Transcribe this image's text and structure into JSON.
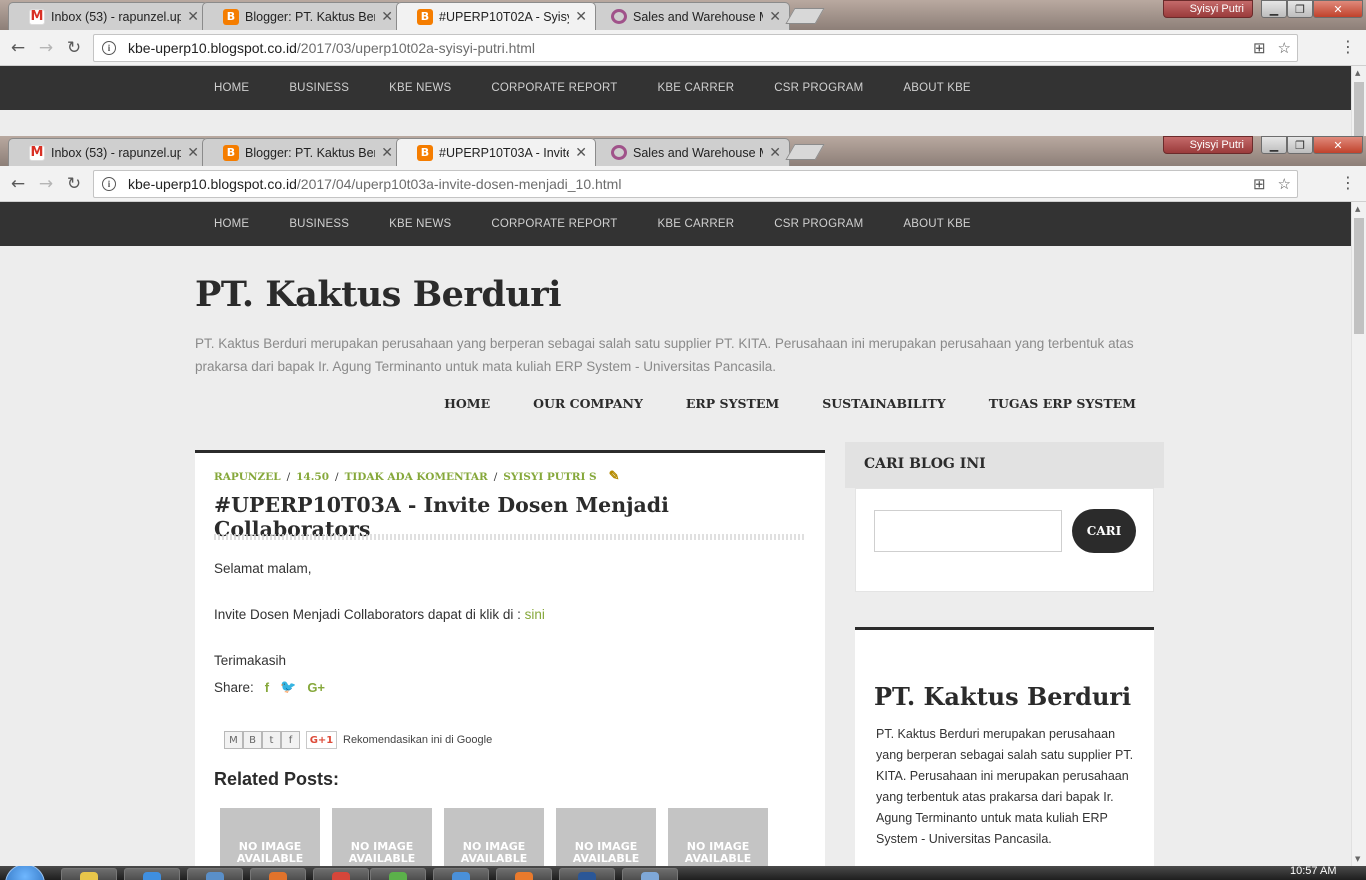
{
  "browser_top": {
    "tabs": [
      {
        "title": "Inbox (53) - rapunzel.upe",
        "icon": "gmail-icon"
      },
      {
        "title": "Blogger: PT. Kaktus Berdu",
        "icon": "blogger-icon"
      },
      {
        "title": "#UPERP10T02A - Syisyi P",
        "icon": "blogger-icon"
      },
      {
        "title": "Sales and Warehouse Ma",
        "icon": "odoo-icon"
      }
    ],
    "user": "Syisyi Putri",
    "url_host": "kbe-uperp10.blogspot.co.id",
    "url_path": "/2017/03/uperp10t02a-syisyi-putri.html"
  },
  "browser_main": {
    "tabs": [
      {
        "title": "Inbox (53) - rapunzel.upe",
        "icon": "gmail-icon"
      },
      {
        "title": "Blogger: PT. Kaktus Berdu",
        "icon": "blogger-icon"
      },
      {
        "title": "#UPERP10T03A - Invite D",
        "icon": "blogger-icon"
      },
      {
        "title": "Sales and Warehouse Ma",
        "icon": "odoo-icon"
      }
    ],
    "user": "Syisyi Putri",
    "url_host": "kbe-uperp10.blogspot.co.id",
    "url_path": "/2017/04/uperp10t03a-invite-dosen-menjadi_10.html"
  },
  "kbe_nav": [
    "HOME",
    "BUSINESS",
    "KBE NEWS",
    "CORPORATE REPORT",
    "KBE CARRER",
    "CSR PROGRAM",
    "ABOUT KBE"
  ],
  "site": {
    "title": "PT. Kaktus Berduri",
    "description": "PT. Kaktus Berduri merupakan perusahaan yang berperan sebagai salah satu supplier PT. KITA. Perusahaan ini merupakan perusahaan yang terbentuk atas prakarsa dari bapak Ir. Agung Terminanto untuk mata kuliah ERP System - Universitas Pancasila."
  },
  "main_menu": [
    "HOME",
    "OUR COMPANY",
    "ERP SYSTEM",
    "SUSTAINABILITY",
    "TUGAS ERP SYSTEM"
  ],
  "post": {
    "meta": {
      "author": "RAPUNZEL",
      "time": "14.50",
      "comments": "TIDAK ADA KOMENTAR",
      "label": "SYISYI PUTRI S"
    },
    "title": "#UPERP10T03A - Invite Dosen Menjadi Collaborators",
    "greeting": "Selamat malam,",
    "line": "Invite Dosen Menjadi Collaborators dapat di klik di : ",
    "link_text": "sini",
    "closing": "Terimakasih",
    "share_label": "Share:",
    "share_icons": {
      "facebook": "f",
      "twitter": "t",
      "googleplus": "G+"
    },
    "sharebar": {
      "email": "M",
      "blog": "B",
      "twitter": "t",
      "facebook": "f",
      "gplus": "G+1",
      "recommend": "Rekomendasikan ini di Google"
    },
    "related_title": "Related Posts:",
    "related_placeholder_1": "NO IMAGE",
    "related_placeholder_2": "AVAILABLE"
  },
  "sidebar": {
    "search_title": "CARI BLOG INI",
    "search_button": "CARI",
    "about_title": "PT. Kaktus Berduri",
    "about_text": "PT. Kaktus Berduri merupakan perusahaan yang berperan sebagai salah satu supplier PT. KITA. Perusahaan ini merupakan perusahaan yang terbentuk atas prakarsa dari bapak Ir. Agung Terminanto untuk mata kuliah ERP System - Universitas Pancasila."
  },
  "taskbar": {
    "clock": "10:57 AM"
  }
}
